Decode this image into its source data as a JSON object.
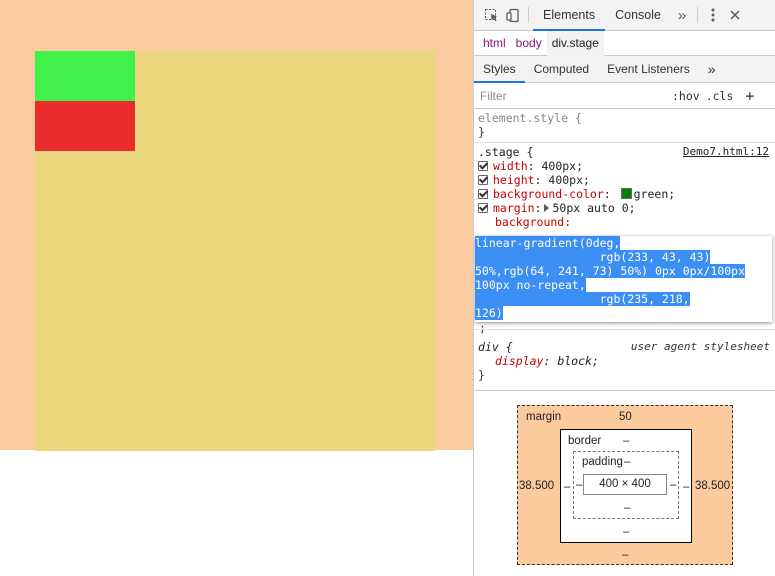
{
  "toolbar": {
    "tabs": [
      "Elements",
      "Console"
    ],
    "more": "»"
  },
  "breadcrumbs": [
    "html",
    "body",
    "div.stage"
  ],
  "subtabs": [
    "Styles",
    "Computed",
    "Event Listeners"
  ],
  "subtabs_more": "»",
  "filter": {
    "placeholder": "Filter",
    "hov": ":hov",
    "cls": ".cls",
    "plus": "+"
  },
  "element_style": {
    "selector": "element.style {",
    "close": "}"
  },
  "stage_rule": {
    "selector": ".stage {",
    "source": "Demo7.html:12",
    "width_prop": "width",
    "width_val": "400px;",
    "height_prop": "height",
    "height_val": "400px;",
    "bg_prop": "background-color",
    "bg_val": "green;",
    "margin_prop": "margin",
    "margin_val": "50px auto 0;",
    "background_prop": "background:",
    "close": ";"
  },
  "editor": {
    "l1": "linear-gradient(0deg,",
    "l2": "                  rgb(233, 43, 43)",
    "l3": "50%,rgb(64, 241, 73) 50%) 0px 0px/100px",
    "l4": "100px no-repeat,",
    "l5": "                  rgb(235, 218,",
    "l6": "126)"
  },
  "div_rule": {
    "selector": "div {",
    "source": "user agent stylesheet",
    "prop": "display",
    "val": "block;",
    "close": "}"
  },
  "box_model": {
    "margin_label": "margin",
    "margin_top": "50",
    "margin_left": "38.500",
    "margin_right": "38.500",
    "margin_bottom": "–",
    "border_label": "border",
    "border_top": "–",
    "border_left": "–",
    "border_right": "–",
    "border_bottom": "–",
    "padding_label": "padding",
    "padding_top": "–",
    "padding_left": "–",
    "padding_right": "–",
    "padding_bottom": "–",
    "content": "400 × 400"
  },
  "colors": {
    "margin": "#fdcba0",
    "stage": "#ebd77e",
    "green_tile": "#40f149",
    "red_tile": "#e92b2b",
    "selection": "#3b8ef3"
  }
}
